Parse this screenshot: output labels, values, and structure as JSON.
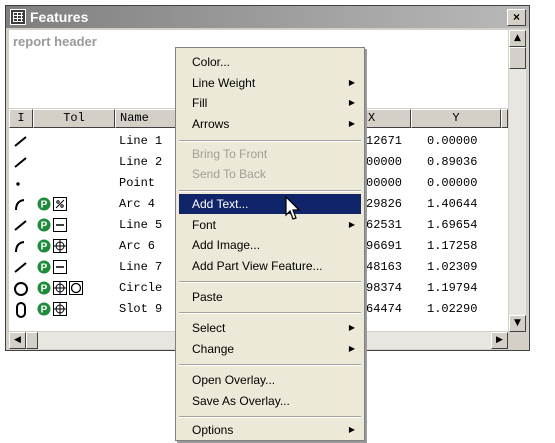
{
  "window": {
    "title": "Features",
    "close_label": "×"
  },
  "report_header": "report header",
  "table": {
    "columns": [
      "I",
      "Tol",
      "Name",
      "X",
      "Y"
    ],
    "rows": [
      {
        "icon": "line-icon",
        "tol": [],
        "name": "Line 1",
        "x": "12671",
        "y": "0.00000"
      },
      {
        "icon": "line-icon",
        "tol": [],
        "name": "Line 2",
        "x": "00000",
        "y": "0.89036"
      },
      {
        "icon": "point-icon",
        "tol": [],
        "name": "Point",
        "x": "00000",
        "y": "0.00000"
      },
      {
        "icon": "arc-icon",
        "tol": [
          "p-badge",
          "profile-icon"
        ],
        "name": "Arc 4",
        "x": "29826",
        "y": "1.40644"
      },
      {
        "icon": "line-icon",
        "tol": [
          "p-badge",
          "straightness-icon"
        ],
        "name": "Line 5",
        "x": "62531",
        "y": "1.69654"
      },
      {
        "icon": "arc-icon",
        "tol": [
          "p-badge",
          "position-icon"
        ],
        "name": "Arc 6",
        "x": "96691",
        "y": "1.17258"
      },
      {
        "icon": "line-icon",
        "tol": [
          "p-badge",
          "straightness-icon"
        ],
        "name": "Line 7",
        "x": "48163",
        "y": "1.02309"
      },
      {
        "icon": "circle-icon",
        "tol": [
          "p-badge",
          "position-icon",
          "circularity-icon"
        ],
        "name": "Circle",
        "x": "98374",
        "y": "1.19794"
      },
      {
        "icon": "slot-icon",
        "tol": [
          "p-badge",
          "position-icon"
        ],
        "name": "Slot 9",
        "x": "64474",
        "y": "1.02290"
      }
    ]
  },
  "menu": {
    "items": [
      {
        "label": "Color...",
        "submenu": false,
        "disabled": false
      },
      {
        "label": "Line Weight",
        "submenu": true,
        "disabled": false
      },
      {
        "label": "Fill",
        "submenu": true,
        "disabled": false
      },
      {
        "label": "Arrows",
        "submenu": true,
        "disabled": false
      },
      {
        "label": "Bring To Front",
        "submenu": false,
        "disabled": true
      },
      {
        "label": "Send To Back",
        "submenu": false,
        "disabled": true
      },
      {
        "label": "Add Text...",
        "submenu": false,
        "disabled": false,
        "highlighted": true
      },
      {
        "label": "Font",
        "submenu": true,
        "disabled": false
      },
      {
        "label": "Add Image...",
        "submenu": false,
        "disabled": false
      },
      {
        "label": "Add Part View Feature...",
        "submenu": false,
        "disabled": false
      },
      {
        "label": "Paste",
        "submenu": false,
        "disabled": false
      },
      {
        "label": "Select",
        "submenu": true,
        "disabled": false
      },
      {
        "label": "Change",
        "submenu": true,
        "disabled": false
      },
      {
        "label": "Open Overlay...",
        "submenu": false,
        "disabled": false
      },
      {
        "label": "Save As Overlay...",
        "submenu": false,
        "disabled": false
      },
      {
        "label": "Options",
        "submenu": true,
        "disabled": false
      }
    ],
    "highlight_color": "#10246a"
  },
  "colors": {
    "p_badge": "#1e8c3a",
    "menu_bg": "#ece9d8",
    "chrome": "#d4d0c8"
  }
}
